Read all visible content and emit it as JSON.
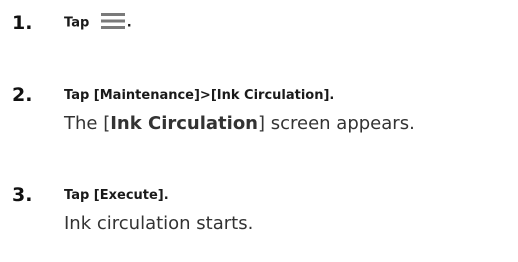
{
  "steps": [
    {
      "number": "1.",
      "title_prefix": "Tap ",
      "title_suffix": ".",
      "icon": "hamburger-menu-icon"
    },
    {
      "number": "2.",
      "title": "Tap [Maintenance]>[Ink Circulation].",
      "desc_prefix": "The [",
      "desc_bold": "Ink Circulation",
      "desc_suffix": "] screen appears."
    },
    {
      "number": "3.",
      "title": "Tap [Execute].",
      "desc": "Ink circulation starts."
    }
  ],
  "colors": {
    "icon_bars": "#7a7a7a",
    "text": "#1a1a1a"
  }
}
